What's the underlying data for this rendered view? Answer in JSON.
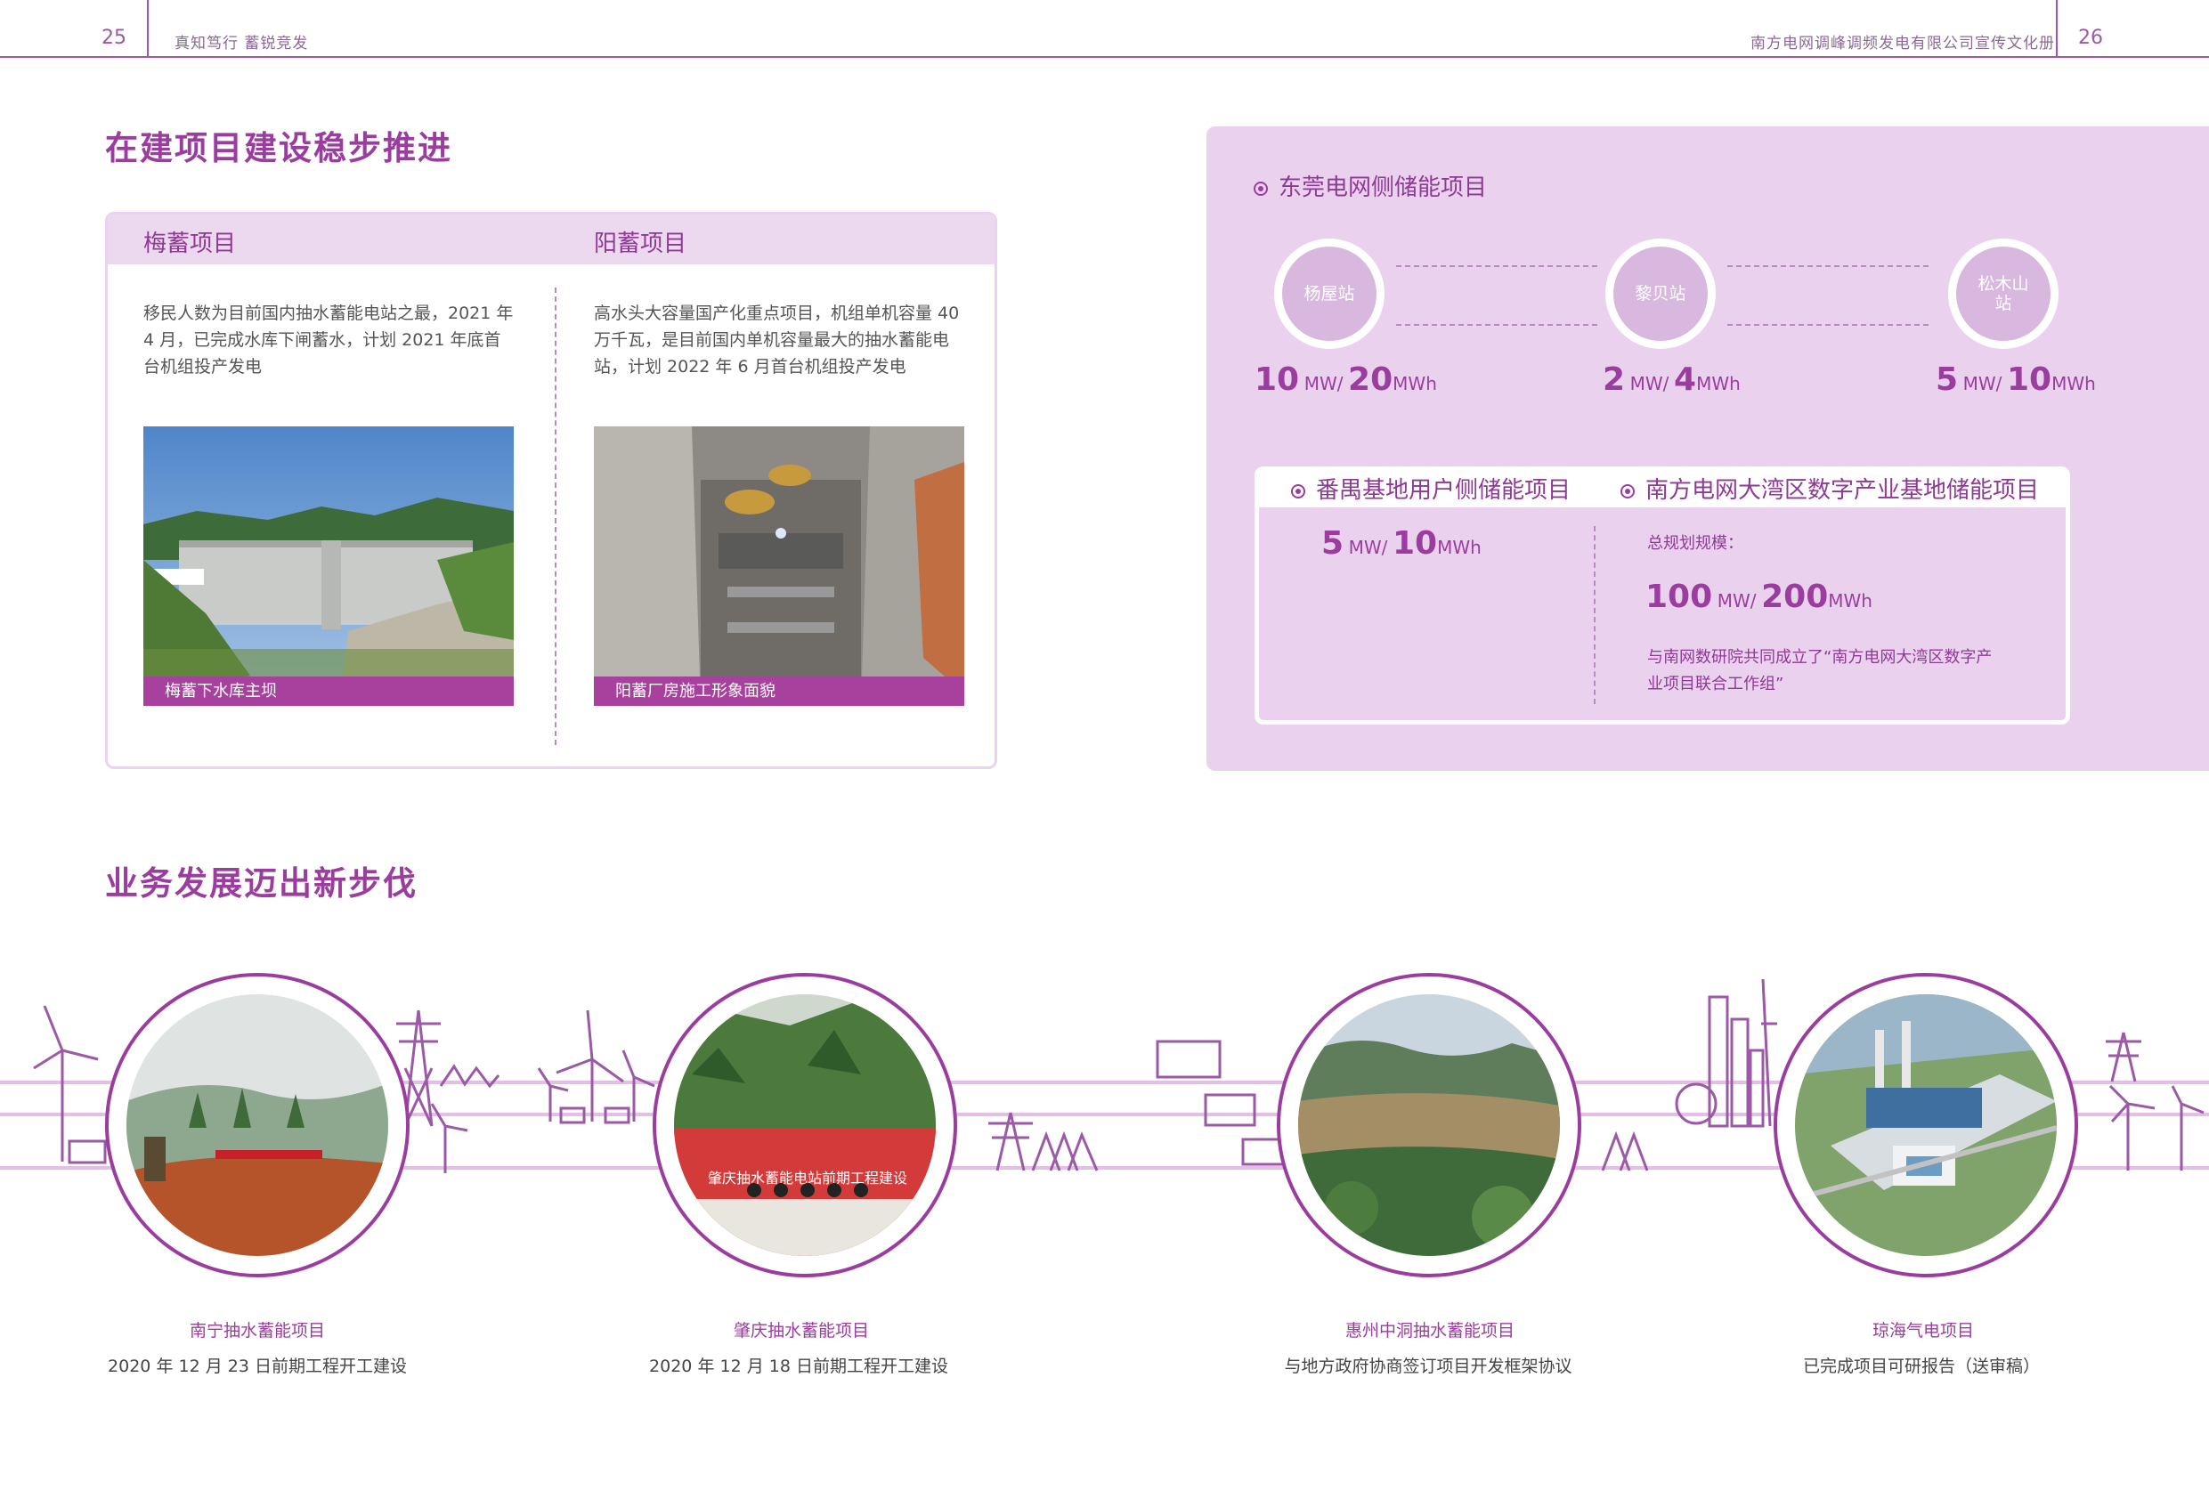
{
  "header": {
    "page_left": "25",
    "slogan": "真知笃行 蓄锐竞发",
    "company": "南方电网调峰调频发电有限公司宣传文化册",
    "page_right": "26"
  },
  "construction": {
    "title": "在建项目建设稳步推进",
    "meixu": {
      "heading": "梅蓄项目",
      "text": "移民人数为目前国内抽水蓄能电站之最，2021 年 4 月，已完成水库下闸蓄水，计划 2021 年底首台机组投产发电",
      "caption": "梅蓄下水库主坝"
    },
    "yangxu": {
      "heading": "阳蓄项目",
      "text": "高水头大容量国产化重点项目，机组单机容量 40 万千瓦，是目前国内单机容量最大的抽水蓄能电站，计划 2022 年 6 月首台机组投产发电",
      "caption": "阳蓄厂房施工形象面貌"
    }
  },
  "storage": {
    "dongguan_title": "东莞电网侧储能项目",
    "stations": [
      {
        "name": "杨屋站",
        "mw": "10",
        "mwh": "20"
      },
      {
        "name": "黎贝站",
        "mw": "2",
        "mwh": "4"
      },
      {
        "name": "松木山站",
        "mw": "5",
        "mwh": "10"
      }
    ],
    "unit_mw": "MW/",
    "unit_mwh": "MWh",
    "panyu_title": "番禺基地用户侧储能项目",
    "panyu_mw": "5",
    "panyu_mwh": "10",
    "bay_title": "南方电网大湾区数字产业基地储能项目",
    "bay_scale_label": "总规划规模：",
    "bay_mw": "100",
    "bay_mwh": "200",
    "bay_note": "与南网数研院共同成立了“南方电网大湾区数字产业项目联合工作组”"
  },
  "business": {
    "title": "业务发展迈出新步伐",
    "items": [
      {
        "name": "南宁抽水蓄能项目",
        "desc": "2020 年 12 月 23 日前期工程开工建设"
      },
      {
        "name": "肇庆抽水蓄能项目",
        "desc": "2020 年 12 月 18 日前期工程开工建设"
      },
      {
        "name": "惠州中洞抽水蓄能项目",
        "desc": "与地方政府协商签订项目开发框架协议"
      },
      {
        "name": "琼海气电项目",
        "desc": "已完成项目可研报告（送审稿）"
      }
    ],
    "photo_banner": "肇庆抽水蓄能电站前期工程建设"
  },
  "colors": {
    "accent": "#9b3d9e",
    "panel": "#ead2ee",
    "light": "#ecd9ef"
  }
}
